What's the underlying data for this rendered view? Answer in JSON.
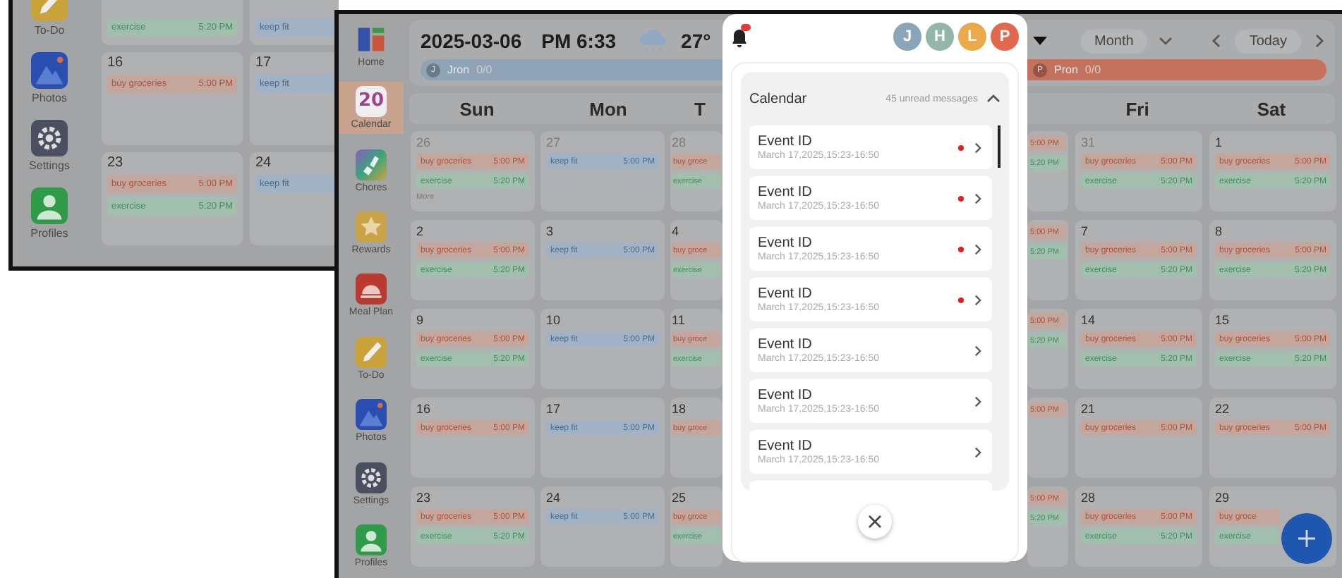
{
  "background_window": {
    "sidebar": [
      {
        "kind": "todo",
        "label": "To-Do"
      },
      {
        "kind": "photos",
        "label": "Photos"
      },
      {
        "kind": "settings",
        "label": "Settings"
      },
      {
        "kind": "profiles",
        "label": "Profiles"
      }
    ],
    "weeks": [
      {
        "cells": [
          {
            "events": [
              {
                "kind": "exercise",
                "label": "exercise",
                "time": "5:20 PM"
              }
            ]
          },
          {
            "events": [
              {
                "kind": "fitness",
                "label": "keep fit"
              }
            ]
          }
        ]
      },
      {
        "cells": [
          {
            "day": "16",
            "events": [
              {
                "kind": "groceries",
                "label": "buy groceries",
                "time": "5:00 PM"
              }
            ]
          },
          {
            "day": "17",
            "events": [
              {
                "kind": "fitness",
                "label": "keep fit"
              }
            ]
          }
        ]
      },
      {
        "cells": [
          {
            "day": "23",
            "events": [
              {
                "kind": "groceries",
                "label": "buy groceries",
                "time": "5:00 PM"
              },
              {
                "kind": "exercise",
                "label": "exercise",
                "time": "5:20 PM"
              }
            ]
          },
          {
            "day": "24",
            "events": [
              {
                "kind": "fitness",
                "label": "keep fit"
              }
            ]
          }
        ]
      }
    ]
  },
  "sidebar": [
    {
      "kind": "home",
      "label": "Home",
      "selected": false
    },
    {
      "kind": "calendar",
      "label": "Calendar",
      "icon_text": "20",
      "selected": true
    },
    {
      "kind": "chores",
      "label": "Chores",
      "selected": false
    },
    {
      "kind": "rewards",
      "label": "Rewards",
      "selected": false
    },
    {
      "kind": "meal",
      "label": "Meal Plan",
      "selected": false
    },
    {
      "kind": "todo",
      "label": "To-Do",
      "selected": false
    },
    {
      "kind": "photos",
      "label": "Photos",
      "selected": false
    },
    {
      "kind": "settings",
      "label": "Settings",
      "selected": false
    },
    {
      "kind": "profiles",
      "label": "Profiles",
      "selected": false
    }
  ],
  "header": {
    "date": "2025-03-06",
    "time": "PM 6:33",
    "temperature": "27°",
    "view": "Month",
    "today": "Today"
  },
  "members": [
    {
      "initial": "J",
      "name": "Jron",
      "count": "0/0",
      "color": "#8ea3b5"
    },
    {
      "initial": "P",
      "name": "Pron",
      "count": "0/0",
      "color": "#c4725e"
    }
  ],
  "weekdays_left": [
    "Sun",
    "Mon",
    "T"
  ],
  "weekdays_right": [
    "Fri",
    "Sat"
  ],
  "weeks": [
    {
      "left": [
        {
          "day": "26",
          "muted": true,
          "events": [
            {
              "kind": "groceries",
              "label": "buy groceries",
              "time": "5:00 PM"
            },
            {
              "kind": "exercise",
              "label": "exercise",
              "time": "5:20 PM"
            }
          ],
          "more": "More"
        },
        {
          "day": "27",
          "muted": true,
          "events": [
            {
              "kind": "fitness",
              "label": "keep fit",
              "time": "5:00 PM"
            }
          ]
        },
        {
          "day": "28",
          "muted": true,
          "events": [
            {
              "kind": "groceries",
              "label": "buy groce"
            },
            {
              "kind": "exercise",
              "label": "exercise"
            }
          ]
        }
      ],
      "right": [
        {
          "events": [
            {
              "kind": "groceries",
              "time": "5:00 PM"
            },
            {
              "kind": "exercise",
              "time": "5:20 PM"
            }
          ]
        },
        {
          "day": "31",
          "muted": true,
          "events": [
            {
              "kind": "groceries",
              "label": "buy groceries",
              "time": "5:00 PM"
            },
            {
              "kind": "exercise",
              "label": "exercise",
              "time": "5:20 PM"
            }
          ]
        },
        {
          "day": "1",
          "muted": false,
          "events": [
            {
              "kind": "groceries",
              "label": "buy groceries",
              "time": "5:00 PM"
            },
            {
              "kind": "exercise",
              "label": "exercise",
              "time": "5:20 PM"
            }
          ]
        }
      ]
    },
    {
      "left": [
        {
          "day": "2",
          "muted": false,
          "events": [
            {
              "kind": "groceries",
              "label": "buy groceries",
              "time": "5:00 PM"
            },
            {
              "kind": "exercise",
              "label": "exercise",
              "time": "5:20 PM"
            }
          ]
        },
        {
          "day": "3",
          "muted": false,
          "events": [
            {
              "kind": "fitness",
              "label": "keep fit",
              "time": "5:00 PM"
            }
          ]
        },
        {
          "day": "4",
          "muted": false,
          "events": [
            {
              "kind": "groceries",
              "label": "buy groce"
            },
            {
              "kind": "exercise",
              "label": "exercise"
            }
          ]
        }
      ],
      "right": [
        {
          "events": [
            {
              "kind": "groceries",
              "time": "5:00 PM"
            },
            {
              "kind": "exercise",
              "time": "5:20 PM"
            }
          ]
        },
        {
          "day": "7",
          "muted": false,
          "events": [
            {
              "kind": "groceries",
              "label": "buy groceries",
              "time": "5:00 PM"
            },
            {
              "kind": "exercise",
              "label": "exercise",
              "time": "5:20 PM"
            }
          ]
        },
        {
          "day": "8",
          "muted": false,
          "events": [
            {
              "kind": "groceries",
              "label": "buy groceries",
              "time": "5:00 PM"
            },
            {
              "kind": "exercise",
              "label": "exercise",
              "time": "5:20 PM"
            }
          ]
        }
      ]
    },
    {
      "left": [
        {
          "day": "9",
          "muted": false,
          "events": [
            {
              "kind": "groceries",
              "label": "buy groceries",
              "time": "5:00 PM"
            },
            {
              "kind": "exercise",
              "label": "exercise",
              "time": "5:20 PM"
            }
          ]
        },
        {
          "day": "10",
          "muted": false,
          "events": [
            {
              "kind": "fitness",
              "label": "keep fit",
              "time": "5:00 PM"
            }
          ]
        },
        {
          "day": "11",
          "muted": false,
          "events": [
            {
              "kind": "groceries",
              "label": "buy groce"
            },
            {
              "kind": "exercise",
              "label": "exercise"
            }
          ]
        }
      ],
      "right": [
        {
          "events": [
            {
              "kind": "groceries",
              "time": "5:00 PM"
            },
            {
              "kind": "exercise",
              "time": "5:20 PM"
            }
          ]
        },
        {
          "day": "14",
          "muted": false,
          "events": [
            {
              "kind": "groceries",
              "label": "buy groceries",
              "time": "5:00 PM"
            },
            {
              "kind": "exercise",
              "label": "exercise",
              "time": "5:20 PM"
            }
          ]
        },
        {
          "day": "15",
          "muted": false,
          "events": [
            {
              "kind": "groceries",
              "label": "buy groceries",
              "time": "5:00 PM"
            },
            {
              "kind": "exercise",
              "label": "exercise",
              "time": "5:20 PM"
            }
          ]
        }
      ]
    },
    {
      "left": [
        {
          "day": "16",
          "muted": false,
          "events": [
            {
              "kind": "groceries",
              "label": "buy groceries",
              "time": "5:00 PM"
            }
          ]
        },
        {
          "day": "17",
          "muted": false,
          "events": [
            {
              "kind": "fitness",
              "label": "keep fit",
              "time": "5:00 PM"
            }
          ]
        },
        {
          "day": "18",
          "muted": false,
          "events": [
            {
              "kind": "groceries",
              "label": "buy groce"
            }
          ]
        }
      ],
      "right": [
        {
          "events": [
            {
              "kind": "groceries",
              "time": "5:00 PM"
            }
          ]
        },
        {
          "day": "21",
          "muted": false,
          "events": [
            {
              "kind": "groceries",
              "label": "buy groceries",
              "time": "5:00 PM"
            }
          ]
        },
        {
          "day": "22",
          "muted": false,
          "events": [
            {
              "kind": "groceries",
              "label": "buy groceries",
              "time": "5:00 PM"
            }
          ]
        }
      ]
    },
    {
      "left": [
        {
          "day": "23",
          "muted": false,
          "events": [
            {
              "kind": "groceries",
              "label": "buy groceries",
              "time": "5:00 PM"
            },
            {
              "kind": "exercise",
              "label": "exercise",
              "time": "5:20 PM"
            }
          ]
        },
        {
          "day": "24",
          "muted": false,
          "events": [
            {
              "kind": "fitness",
              "label": "keep fit",
              "time": "5:00 PM"
            }
          ]
        },
        {
          "day": "25",
          "muted": false,
          "events": [
            {
              "kind": "groceries",
              "label": "buy groce"
            },
            {
              "kind": "exercise",
              "label": "exercise"
            }
          ]
        }
      ],
      "right": [
        {
          "events": [
            {
              "kind": "groceries",
              "time": "5:00 PM"
            },
            {
              "kind": "exercise",
              "time": "5:20 PM"
            }
          ]
        },
        {
          "day": "28",
          "muted": false,
          "events": [
            {
              "kind": "groceries",
              "label": "buy groceries",
              "time": "5:00 PM"
            },
            {
              "kind": "exercise",
              "label": "exercise",
              "time": "5:20 PM"
            }
          ]
        },
        {
          "day": "29",
          "muted": false,
          "events": [
            {
              "kind": "groceries",
              "label": "buy groce"
            },
            {
              "kind": "exercise",
              "label": "exercise"
            }
          ]
        }
      ]
    }
  ],
  "notifications": {
    "avatars": [
      {
        "initial": "J",
        "color": "#8aa5b8"
      },
      {
        "initial": "H",
        "color": "#93b5ab"
      },
      {
        "initial": "L",
        "color": "#eaa94a"
      },
      {
        "initial": "P",
        "color": "#e2684e"
      }
    ],
    "section": {
      "title": "Calendar",
      "summary": "45 unread messages",
      "expanded": true,
      "items": [
        {
          "title": "Event ID",
          "date": "March 17,2025,15:23-16:50",
          "unread": true
        },
        {
          "title": "Event ID",
          "date": "March 17,2025,15:23-16:50",
          "unread": true
        },
        {
          "title": "Event ID",
          "date": "March 17,2025,15:23-16:50",
          "unread": true
        },
        {
          "title": "Event ID",
          "date": "March 17,2025,15:23-16:50",
          "unread": true
        },
        {
          "title": "Event ID",
          "date": "March 17,2025,15:23-16:50",
          "unread": false
        },
        {
          "title": "Event ID",
          "date": "March 17,2025,15:23-16:50",
          "unread": false
        },
        {
          "title": "Event ID",
          "date": "March 17,2025,15:23-16:50",
          "unread": false
        }
      ]
    }
  }
}
